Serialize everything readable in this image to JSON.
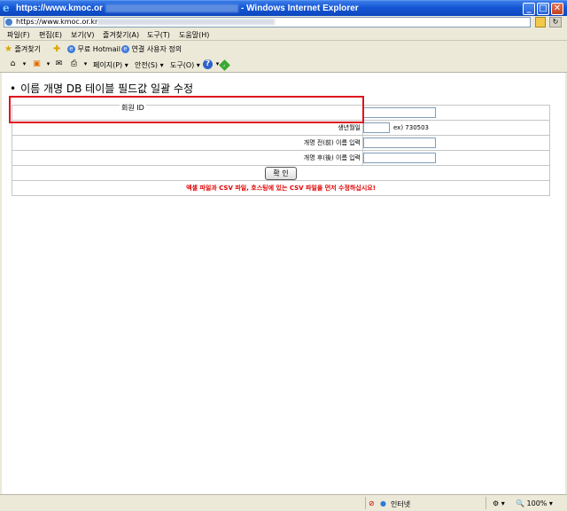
{
  "window": {
    "title_prefix": "https://www.kmoc.or",
    "title_suffix": "- Windows Internet Explorer",
    "minimize": "_",
    "maximize": "□",
    "close": "✕"
  },
  "address": {
    "url": "https://www.kmoc.or.kr"
  },
  "menu": [
    "파일(F)",
    "편집(E)",
    "보기(V)",
    "즐겨찾기(A)",
    "도구(T)",
    "도움말(H)"
  ],
  "favorites_bar": {
    "favorites_label": "즐겨찾기",
    "hotmail_label": "무료 Hotmail",
    "custom_links_label": "연결 사용자 정의"
  },
  "command_bar": {
    "page_label": "페이지(P)",
    "safety_label": "안전(S)",
    "tools_label": "도구(O)"
  },
  "page": {
    "heading": "이름 개명 DB 테이블 필드값 일괄 수정",
    "member_id_label": "회원 ID",
    "birthdate_label": "생년월일",
    "birthdate_hint": "ex) 730503",
    "old_name_label": "개명 전(前) 이름 입력",
    "new_name_label": "개명 후(後) 이름 입력",
    "confirm_button": "확 인",
    "warning": "엑셀 파일과 CSV 파일, 호스팅에 있는 CSV 파일을 먼저 수정하십시요!"
  },
  "status": {
    "zone": "인터넷",
    "zoom": "100%"
  },
  "colors": {
    "highlight_box": "#e0141e",
    "warning_text": "#e00000",
    "titlebar": "#1556d4"
  }
}
